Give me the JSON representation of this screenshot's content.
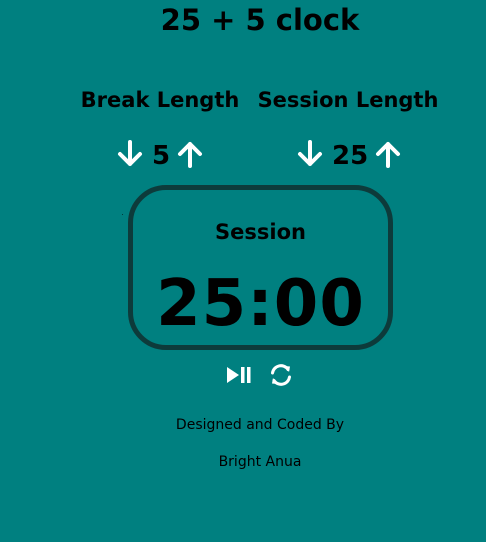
{
  "app": {
    "title": "25 + 5 clock"
  },
  "break": {
    "label": "Break Length",
    "value": "5",
    "decrement_icon": "arrow-down-icon",
    "increment_icon": "arrow-up-icon"
  },
  "session": {
    "label": "Session Length",
    "value": "25",
    "decrement_icon": "arrow-down-icon",
    "increment_icon": "arrow-up-icon"
  },
  "timer": {
    "label": "Session",
    "time": "25:00"
  },
  "controls": {
    "play_pause_icon": "play-pause-icon",
    "reset_icon": "refresh-icon"
  },
  "credits": {
    "line1": "Designed and Coded By",
    "line2": "Bright Anua"
  },
  "colors": {
    "background": "#008080",
    "timer_border": "#0d3b3b",
    "icon": "#ffffff",
    "text": "#000000"
  }
}
